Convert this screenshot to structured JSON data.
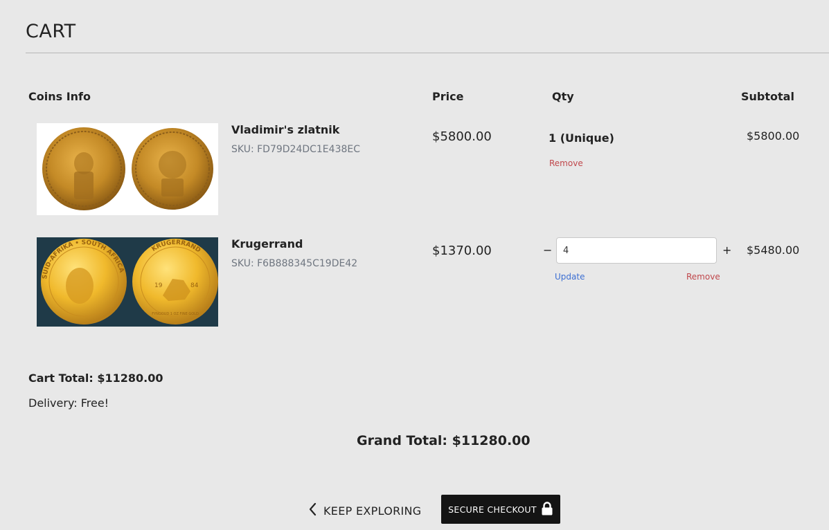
{
  "page": {
    "title": "CART"
  },
  "columns": {
    "info": "Coins Info",
    "price": "Price",
    "qty": "Qty",
    "subtotal": "Subtotal"
  },
  "items": [
    {
      "name": "Vladimir's zlatnik",
      "sku": "SKU: FD79D24DC1E438EC",
      "price": "$5800.00",
      "qty_text": "1 (Unique)",
      "remove_label": "Remove",
      "subtotal": "$5800.00"
    },
    {
      "name": "Krugerrand",
      "sku": "SKU: F6B888345C19DE42",
      "price": "$1370.00",
      "qty_value": "4",
      "minus_label": "−",
      "plus_label": "+",
      "update_label": "Update",
      "remove_label": "Remove",
      "subtotal": "$5480.00",
      "coin_text": {
        "left": "SUID-AFRIKA • SOUTH AFRICA",
        "right": "KRUGERRAND",
        "year_a": "19",
        "year_b": "84",
        "small": "FYNGOUD 1 OZ FINE GOLD"
      }
    }
  ],
  "totals": {
    "cart_total": "Cart Total: $11280.00",
    "delivery": "Delivery: Free!",
    "grand_total": "Grand Total: $11280.00"
  },
  "actions": {
    "keep_exploring": "KEEP EXPLORING",
    "checkout": "SECURE CHECKOUT"
  },
  "icons": {
    "back": "chevron-left-icon",
    "lock": "lock-icon"
  },
  "colors": {
    "background": "#e8e8e8",
    "remove": "#c0474b",
    "update": "#3c6fd3",
    "checkout_bg": "#141414"
  }
}
